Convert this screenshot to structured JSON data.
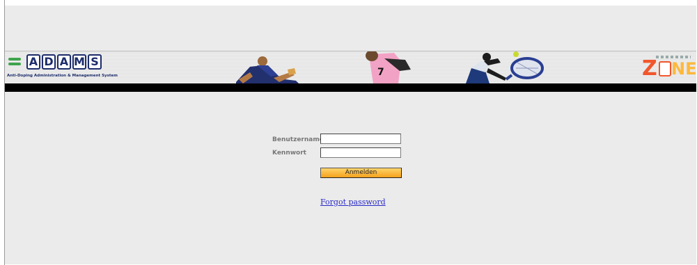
{
  "header": {
    "logo_letters": [
      "A",
      "D",
      "A",
      "M",
      "S"
    ],
    "logo_subtitle": "Anti-Doping Administration & Management System",
    "zone_logo": "ZONE"
  },
  "login": {
    "username_label": "Benutzername",
    "password_label": "Kennwort",
    "username_value": "",
    "password_value": "",
    "submit_label": "Anmelden",
    "forgot_link": "Forgot password"
  },
  "colors": {
    "logo_blue": "#1c2c6b",
    "logo_green": "#3fa34d",
    "zone_orange": "#f1562c",
    "button_orange": "#f4a21c",
    "link_blue": "#2929c8"
  }
}
